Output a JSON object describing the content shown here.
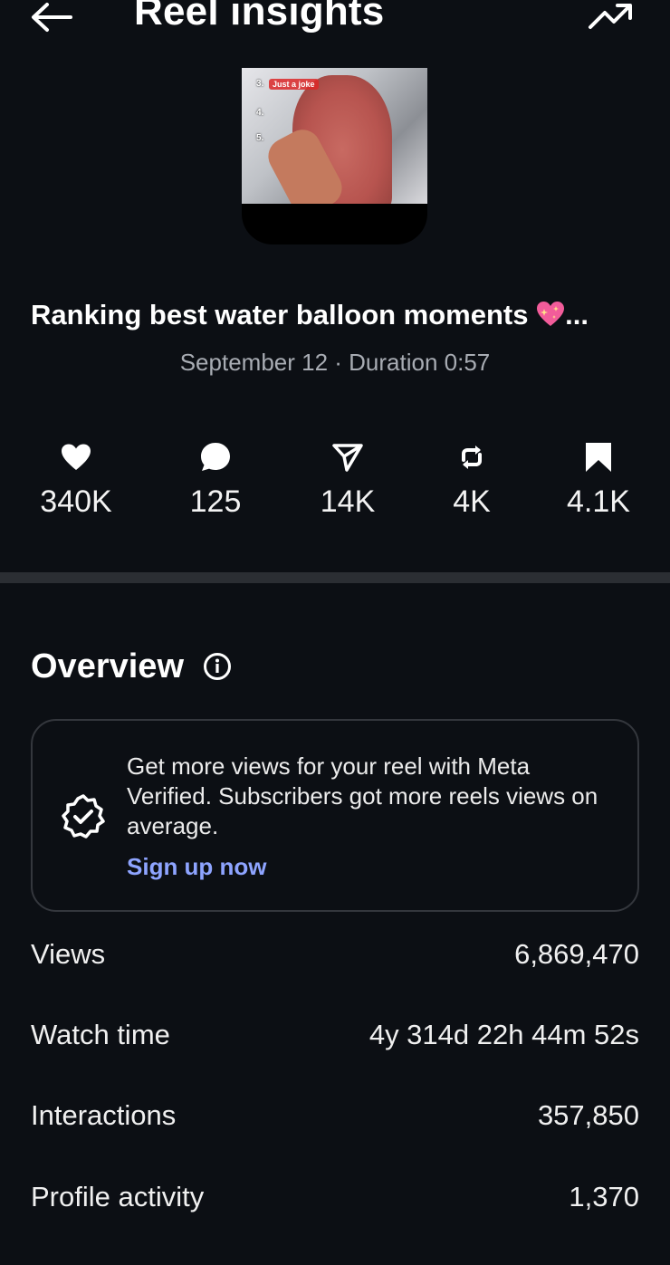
{
  "header": {
    "title": "Reel insights",
    "back_icon": "arrow-left-icon",
    "trend_icon": "trending-up-icon"
  },
  "thumbnail": {
    "overlay_rank3": "3.",
    "overlay_joke": "Just a joke",
    "overlay_rank4": "4.",
    "overlay_rank5": "5."
  },
  "reel": {
    "caption": "Ranking best water balloon moments",
    "caption_suffix": "...",
    "date_line": "September 12 · Duration 0:57"
  },
  "stats": [
    {
      "icon": "heart-icon",
      "value": "340K"
    },
    {
      "icon": "comment-icon",
      "value": "125"
    },
    {
      "icon": "share-icon",
      "value": "14K"
    },
    {
      "icon": "repost-icon",
      "value": "4K"
    },
    {
      "icon": "bookmark-icon",
      "value": "4.1K"
    }
  ],
  "overview": {
    "title": "Overview",
    "promo_text": "Get more views for your reel with Meta Verified. Subscribers got more reels views on average.",
    "promo_link": "Sign up now",
    "metrics": [
      {
        "label": "Views",
        "value": "6,869,470"
      },
      {
        "label": "Watch time",
        "value": "4y 314d 22h 44m 52s"
      },
      {
        "label": "Interactions",
        "value": "357,850"
      },
      {
        "label": "Profile activity",
        "value": "1,370"
      }
    ]
  },
  "colors": {
    "background": "#0c0f14",
    "link": "#8ea4ff",
    "muted_text": "#a8acb3",
    "divider": "#2b2e33"
  }
}
